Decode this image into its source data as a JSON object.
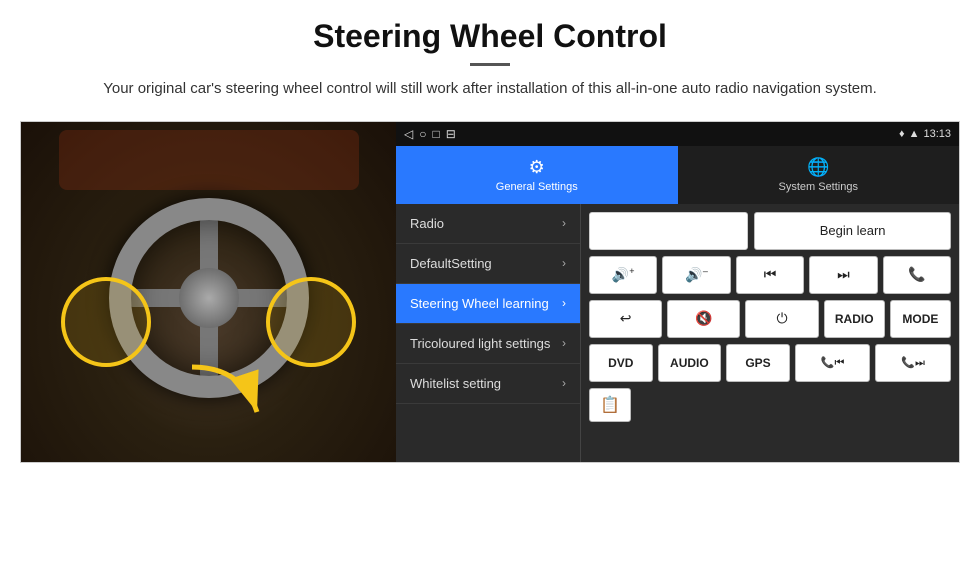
{
  "header": {
    "title": "Steering Wheel Control",
    "subtitle": "Your original car's steering wheel control will still work after installation of this all-in-one auto radio navigation system."
  },
  "status_bar": {
    "time": "13:13",
    "icons_left": [
      "◁",
      "○",
      "□",
      "⊟"
    ]
  },
  "tabs": [
    {
      "id": "general",
      "label": "General Settings",
      "icon": "⚙",
      "active": true
    },
    {
      "id": "system",
      "label": "System Settings",
      "icon": "🌐",
      "active": false
    }
  ],
  "menu_items": [
    {
      "label": "Radio",
      "active": false
    },
    {
      "label": "DefaultSetting",
      "active": false
    },
    {
      "label": "Steering Wheel learning",
      "active": true
    },
    {
      "label": "Tricoloured light settings",
      "active": false
    },
    {
      "label": "Whitelist setting",
      "active": false
    }
  ],
  "controls": {
    "begin_learn_label": "Begin learn",
    "buttons_row2": [
      "🔊+",
      "🔊–",
      "⏮",
      "⏭",
      "📞"
    ],
    "buttons_row3": [
      "↩",
      "🔊✕",
      "⏻",
      "RADIO",
      "MODE"
    ],
    "buttons_row4": [
      "DVD",
      "AUDIO",
      "GPS",
      "📞⏮",
      "📞⏭"
    ],
    "whitelist_icon": "📋"
  }
}
